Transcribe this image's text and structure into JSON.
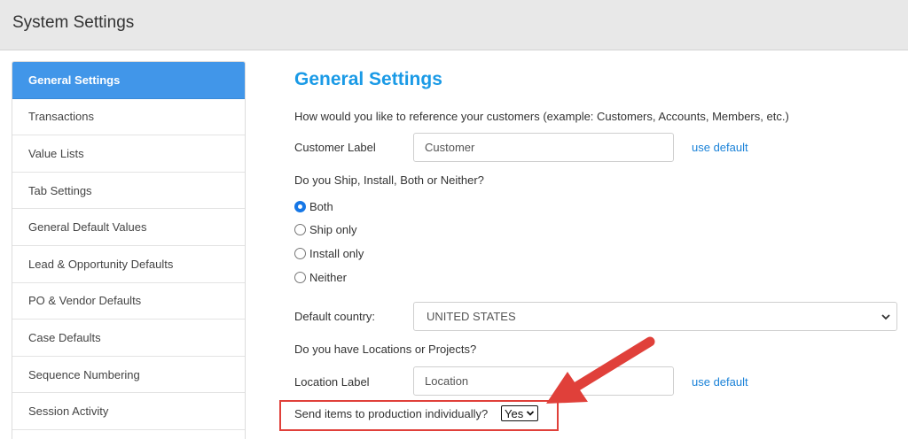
{
  "header": {
    "title": "System Settings"
  },
  "sidebar": {
    "items": [
      {
        "label": "General Settings"
      },
      {
        "label": "Transactions"
      },
      {
        "label": "Value Lists"
      },
      {
        "label": "Tab Settings"
      },
      {
        "label": "General Default Values"
      },
      {
        "label": "Lead & Opportunity Defaults"
      },
      {
        "label": "PO & Vendor Defaults"
      },
      {
        "label": "Case Defaults"
      },
      {
        "label": "Sequence Numbering"
      },
      {
        "label": "Session Activity"
      }
    ]
  },
  "main": {
    "heading": "General Settings",
    "customer_prompt": "How would you like to reference your customers (example: Customers, Accounts, Members, etc.)",
    "customer_label": "Customer Label",
    "customer_value": "Customer",
    "use_default": "use default",
    "ship_prompt": "Do you Ship, Install, Both or Neither?",
    "ship_options": [
      "Both",
      "Ship only",
      "Install only",
      "Neither"
    ],
    "ship_selected": "Both",
    "country_label": "Default country:",
    "country_value": "UNITED STATES",
    "locations_prompt": "Do you have Locations or Projects?",
    "location_label": "Location Label",
    "location_value": "Location",
    "production_label": "Send items to production individually?",
    "production_value": "Yes"
  },
  "colors": {
    "accent": "#1a9ae6",
    "active_sidebar": "#4196e9",
    "link": "#1a82d8",
    "annotation": "#e0403a"
  },
  "icons": [
    "chevron-down-icon",
    "radio-checked-icon",
    "radio-unchecked-icon",
    "red-arrow-annotation"
  ]
}
